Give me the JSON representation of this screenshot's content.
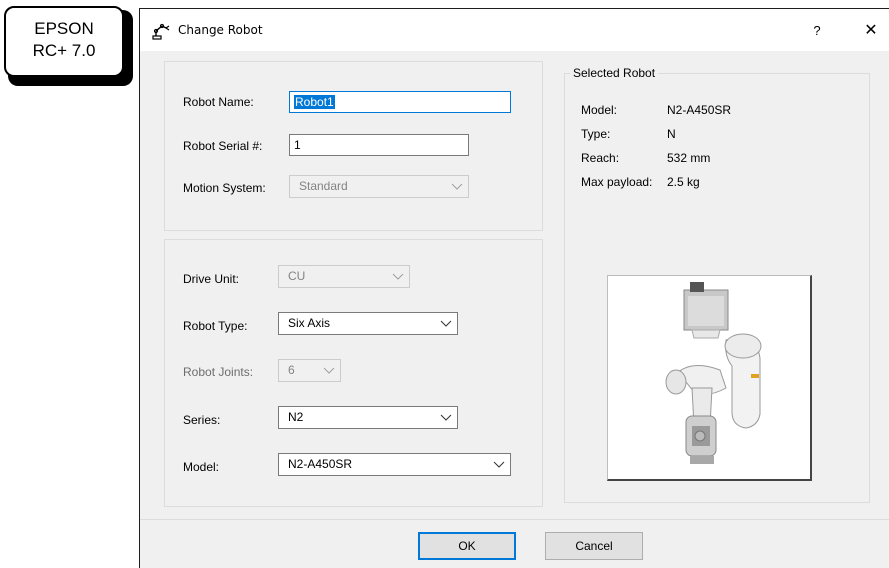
{
  "badge": {
    "line1": "EPSON",
    "line2": "RC+ 7.0"
  },
  "dialog": {
    "title": "Change Robot",
    "help_label": "?",
    "close_label": "✕"
  },
  "robot_info": {
    "name_label": "Robot Name:",
    "name_value": "Robot1",
    "serial_label": "Robot Serial #:",
    "serial_value": "1",
    "motion_label": "Motion System:",
    "motion_value": "Standard"
  },
  "config": {
    "drive_unit_label": "Drive Unit:",
    "drive_unit_value": "CU",
    "robot_type_label": "Robot Type:",
    "robot_type_value": "Six Axis",
    "joints_label": "Robot Joints:",
    "joints_value": "6",
    "series_label": "Series:",
    "series_value": "N2",
    "model_label": "Model:",
    "model_value": "N2-A450SR"
  },
  "selected_robot": {
    "group_label": "Selected Robot",
    "model_label": "Model:",
    "model_value": "N2-A450SR",
    "type_label": "Type:",
    "type_value": "N",
    "reach_label": "Reach:",
    "reach_value": "532 mm",
    "payload_label": "Max payload:",
    "payload_value": "2.5 kg"
  },
  "buttons": {
    "ok": "OK",
    "cancel": "Cancel"
  },
  "colors": {
    "accent": "#0078d7",
    "dialog_bg": "#f0f0f0"
  },
  "icons": [
    "robot-arm-icon",
    "chevron-down-icon",
    "close-icon",
    "help-icon"
  ]
}
